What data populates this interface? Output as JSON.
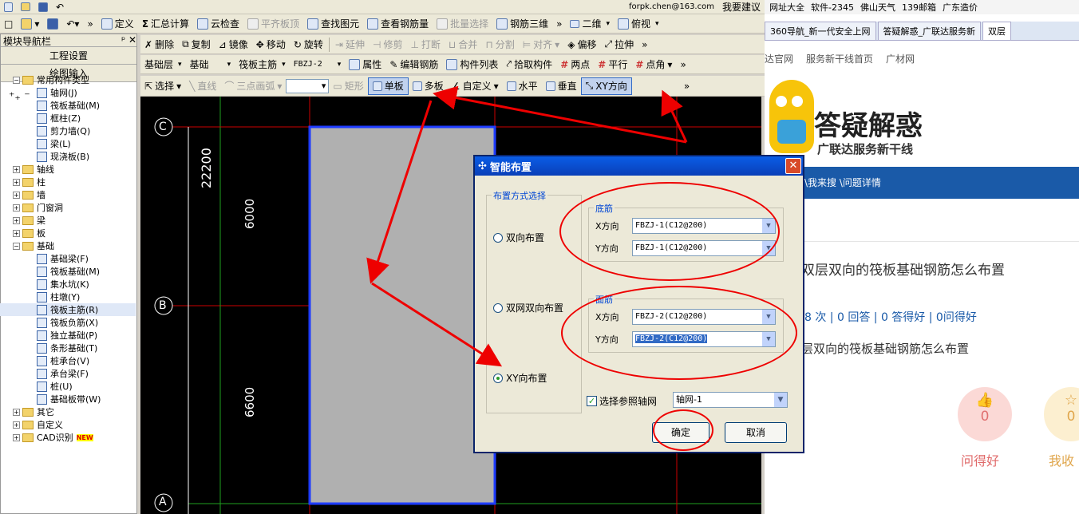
{
  "top_menu": {
    "user": "forpk.chen@163.com",
    "help": "我要建议"
  },
  "toolbar1": {
    "define": "定义",
    "sum": "汇总计算",
    "cloud_check": "云检查",
    "flatten": "平齐板顶",
    "find": "查找图元",
    "view_rebar": "查看钢筋量",
    "batch_select": "批量选择",
    "rebar_3d": "钢筋三维",
    "view_mode": "二维",
    "view_dir": "俯视"
  },
  "toolbar2": {
    "delete": "删除",
    "copy": "复制",
    "mirror": "镜像",
    "move": "移动",
    "rotate": "旋转",
    "extend": "延伸",
    "trim": "修剪",
    "break": "打断",
    "merge": "合并",
    "split": "分割",
    "align": "对齐",
    "offset": "偏移",
    "stretch": "拉伸"
  },
  "toolbar3": {
    "layer": "基础层",
    "category": "基础",
    "type": "筏板主筋",
    "component": "FBZJ-2",
    "props": "属性",
    "edit_rebar": "编辑钢筋",
    "comp_list": "构件列表",
    "pick": "拾取构件",
    "two_point": "两点",
    "parallel": "平行",
    "point_angle": "点角"
  },
  "toolbar4": {
    "select": "选择",
    "line": "直线",
    "arc": "三点画弧",
    "rect": "矩形",
    "single": "单板",
    "multi": "多板",
    "custom": "自定义",
    "horizontal": "水平",
    "vertical": "垂直",
    "xy": "XY方向"
  },
  "nav": {
    "title": "模块导航栏",
    "settings": "工程设置",
    "drawing_input": "绘图输入",
    "common_types": "常用构件类型",
    "common_items": [
      "轴网(J)",
      "筏板基础(M)",
      "框柱(Z)",
      "剪力墙(Q)",
      "梁(L)",
      "现浇板(B)"
    ],
    "folders_a": [
      "轴线",
      "柱",
      "墙",
      "门窗洞",
      "梁",
      "板"
    ],
    "foundation": "基础",
    "foundation_items": [
      "基础梁(F)",
      "筏板基础(M)",
      "集水坑(K)",
      "柱墩(Y)",
      "筏板主筋(R)",
      "筏板负筋(X)",
      "独立基础(P)",
      "条形基础(T)",
      "桩承台(V)",
      "承台梁(F)",
      "桩(U)",
      "基础板带(W)"
    ],
    "folders_b": [
      "其它",
      "自定义",
      "CAD识别"
    ],
    "new_badge": "NEW"
  },
  "canvas": {
    "axis_c": "C",
    "axis_b": "B",
    "axis_a": "A",
    "dim_total": "22200",
    "dim_top": "6000",
    "dim_bottom": "6600"
  },
  "dialog": {
    "title": "智能布置",
    "mode_group": "布置方式选择",
    "opt1": "双向布置",
    "opt2": "双网双向布置",
    "opt3": "XY向布置",
    "bottom_group": "底筋",
    "top_group": "面筋",
    "x_label": "X方向",
    "y_label": "Y方向",
    "bottom_x": "FBZJ-1(C12@200)",
    "bottom_y": "FBZJ-1(C12@200)",
    "top_x": "FBZJ-2(C12@200)",
    "top_y": "FBZJ-2(C12@200)",
    "ref_grid_label": "选择参照轴网",
    "ref_grid": "轴网-1",
    "ok": "确定",
    "cancel": "取消"
  },
  "browser": {
    "bookmarks": [
      "网址大全",
      "软件-2345",
      "佛山天气",
      "139邮箱",
      "广东造价"
    ],
    "tabs": [
      "360导航_新一代安全上网",
      "答疑解惑_广联达服务新",
      "双层"
    ],
    "links": [
      "达官网",
      "服务新干线首页",
      "广材网"
    ],
    "logo_title": "答疑解惑",
    "logo_sub": "广联达服务新干线",
    "breadcrumb": "\\我来搜 \\问题详情",
    "question_title": "双层双向的筏板基础钢筋怎么布置",
    "stats": "8 次 | 0 回答 | 0 答得好 | 0问得好",
    "question_body": "层双向的筏板基础钢筋怎么布置",
    "good_count": "0",
    "good_label": "问得好",
    "fav_count": "0",
    "fav_label": "我收"
  }
}
